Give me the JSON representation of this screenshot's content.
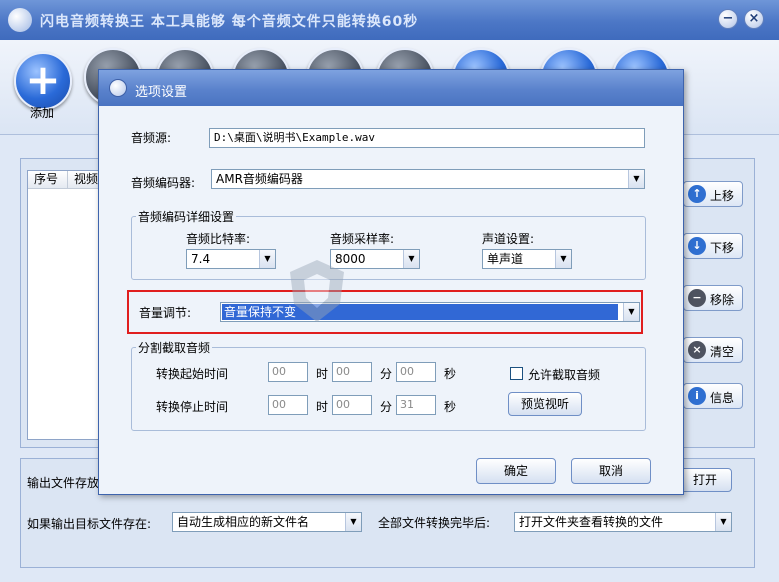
{
  "main_window": {
    "title": "闪电音频转换王  本工具能够 每个音频文件只能转换60秒",
    "controls": {
      "minimize": "−",
      "close": "×"
    }
  },
  "toolbar": {
    "add_label": "添加"
  },
  "file_list": {
    "columns": [
      "序号",
      "视频"
    ]
  },
  "side_buttons": [
    {
      "label": "上移",
      "icon": "arrow-up-icon",
      "color": "#2f6fd1"
    },
    {
      "label": "下移",
      "icon": "arrow-down-icon",
      "color": "#2f6fd1"
    },
    {
      "label": "移除",
      "icon": "minus-icon",
      "color": "#4e5360"
    },
    {
      "label": "清空",
      "icon": "clear-x-icon",
      "color": "#4e5360"
    },
    {
      "label": "信息",
      "icon": "info-icon",
      "color": "#2f6fd1"
    }
  ],
  "bottom": {
    "output_folder_label": "输出文件存放",
    "open_button": "打开",
    "if_exists_label": "如果输出目标文件存在:",
    "if_exists_value": "自动生成相应的新文件名",
    "after_all_label": "全部文件转换完毕后:",
    "after_all_value": "打开文件夹查看转换的文件"
  },
  "dialog": {
    "title": "选项设置",
    "source_label": "音频源:",
    "source_value": "D:\\桌面\\说明书\\Example.wav",
    "encoder_label": "音频编码器:",
    "encoder_value": "AMR音频编码器",
    "detail_group": "音频编码详细设置",
    "bitrate_label": "音频比特率:",
    "bitrate_value": "7.4",
    "samplerate_label": "音频采样率:",
    "samplerate_value": "8000",
    "channel_label": "声道设置:",
    "channel_value": "单声道",
    "volume_label": "音量调节:",
    "volume_value": "音量保持不变",
    "split_group": "分割截取音频",
    "start_label": "转换起始时间",
    "stop_label": "转换停止时间",
    "hour": "时",
    "minute": "分",
    "second": "秒",
    "start_h": "00",
    "start_m": "00",
    "start_s": "00",
    "stop_h": "00",
    "stop_m": "00",
    "stop_s": "31",
    "allow_cut_label": "允许截取音频",
    "preview_button": "预览视听",
    "ok_button": "确定",
    "cancel_button": "取消"
  },
  "watermark": {
    "text": "安下载",
    "sub": "anxz.com"
  },
  "colors": {
    "accent": "#4a73c1",
    "highlight_border": "#e01e1e",
    "selection": "#3168d5"
  }
}
